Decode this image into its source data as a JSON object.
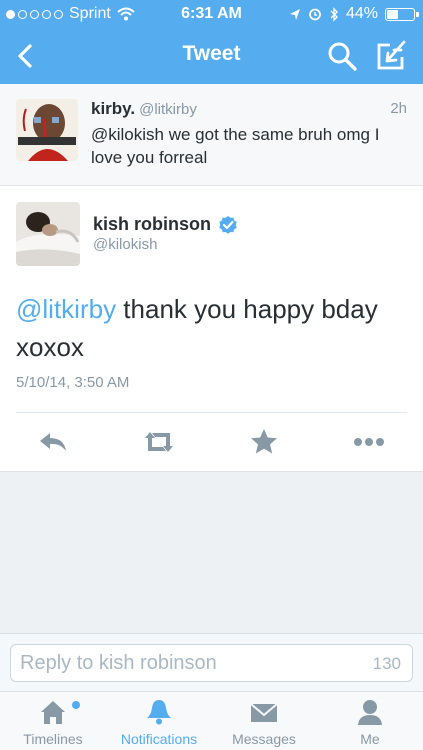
{
  "status": {
    "carrier": "Sprint",
    "time": "6:31 AM",
    "battery": "44%",
    "battery_level": 0.44,
    "signal_bars": 1
  },
  "nav": {
    "title": "Tweet"
  },
  "parent_tweet": {
    "name": "kirby.",
    "handle": "@litkirby",
    "time": "2h",
    "text": "@kilokish we got the same bruh omg I love you forreal"
  },
  "main_tweet": {
    "name": "kish robinson",
    "handle": "@kilokish",
    "mention": "@litkirby",
    "text": " thank you happy bday xoxox",
    "date": "5/10/14, 3:50 AM"
  },
  "reply": {
    "placeholder": "Reply to kish robinson",
    "char_count": "130"
  },
  "tabs": [
    {
      "label": "Timelines",
      "icon": "home-icon"
    },
    {
      "label": "Notifications",
      "icon": "bell-icon"
    },
    {
      "label": "Messages",
      "icon": "envelope-icon"
    },
    {
      "label": "Me",
      "icon": "person-icon"
    }
  ],
  "colors": {
    "brand": "#55acee",
    "text": "#292f33",
    "muted": "#8899a6"
  }
}
